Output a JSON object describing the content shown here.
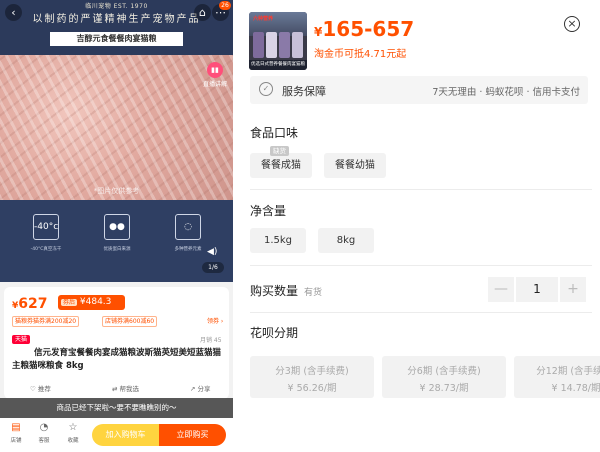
{
  "left": {
    "brand_line": "临川宠物 EST. 1970",
    "slogan": "以制药的严谨精神生产宠物产品",
    "product_banner": "吉醇元食餐餐肉宴猫粮",
    "nav_badge": "26",
    "live_label": "直播讲解",
    "photo_caption": "*图片仅供参考",
    "features": [
      {
        "icon": "-40°c",
        "label": "-40°C真空冻干"
      },
      {
        "icon": "●●",
        "label": "优质蛋白来源"
      },
      {
        "icon": "◌",
        "label": "多种营养元素"
      }
    ],
    "page_indicator": "1/6",
    "price": "627",
    "currency": "¥",
    "coupon_pre": "券后",
    "coupon_price": "¥484.3",
    "promos": [
      "猫粮券猫券满200减20",
      "店铺券满600减60"
    ],
    "promo_more": "领券 ›",
    "tmall_tag": "天猫",
    "sales": "月销 45",
    "title": "信元发育宝餐餐肉宴成猫粮波斯猫英短美短蓝猫猫主粮猫咪粮食 8kg",
    "actions": [
      "推荐",
      "帮我选",
      "分享"
    ],
    "offshelf_notice": "商品已经下架啦～要不要瞧瞧别的～",
    "tabs": [
      "店铺",
      "客服",
      "收藏"
    ],
    "cart_button": "加入购物车",
    "buy_button": "立即购买"
  },
  "right": {
    "thumb_label": "优选日式营养餐餐肉宴猫粮",
    "thumb_red": "六种营养",
    "currency": "¥",
    "price_range": "165-657",
    "coin_text": "淘金币可抵4.71元起",
    "close_icon": "×",
    "service_title": "服务保障",
    "service_detail": "7天无理由 · 蚂蚁花呗 · 信用卡支付",
    "flavor_title": "食品口味",
    "flavor_options": [
      {
        "label": "餐餐成猫",
        "tag": "缺货"
      },
      {
        "label": "餐餐幼猫",
        "tag": ""
      }
    ],
    "weight_title": "净含量",
    "weight_options": [
      "1.5kg",
      "8kg"
    ],
    "qty_title": "购买数量",
    "qty_stock": "有货",
    "qty_minus": "—",
    "qty_value": "1",
    "qty_plus": "+",
    "installment_title": "花呗分期",
    "installments": [
      {
        "line1": "分3期 (含手续费)",
        "line2": "¥ 56.26/期"
      },
      {
        "line1": "分6期 (含手续费)",
        "line2": "¥ 28.73/期"
      },
      {
        "line1": "分12期 (含手续费)",
        "line2": "¥ 14.78/期"
      }
    ]
  },
  "colors": {
    "accent_orange": "#ff5000",
    "cart_yellow": "#ffc600",
    "hero_navy": "#2e3f63",
    "option_bg": "#f2f2f2"
  }
}
